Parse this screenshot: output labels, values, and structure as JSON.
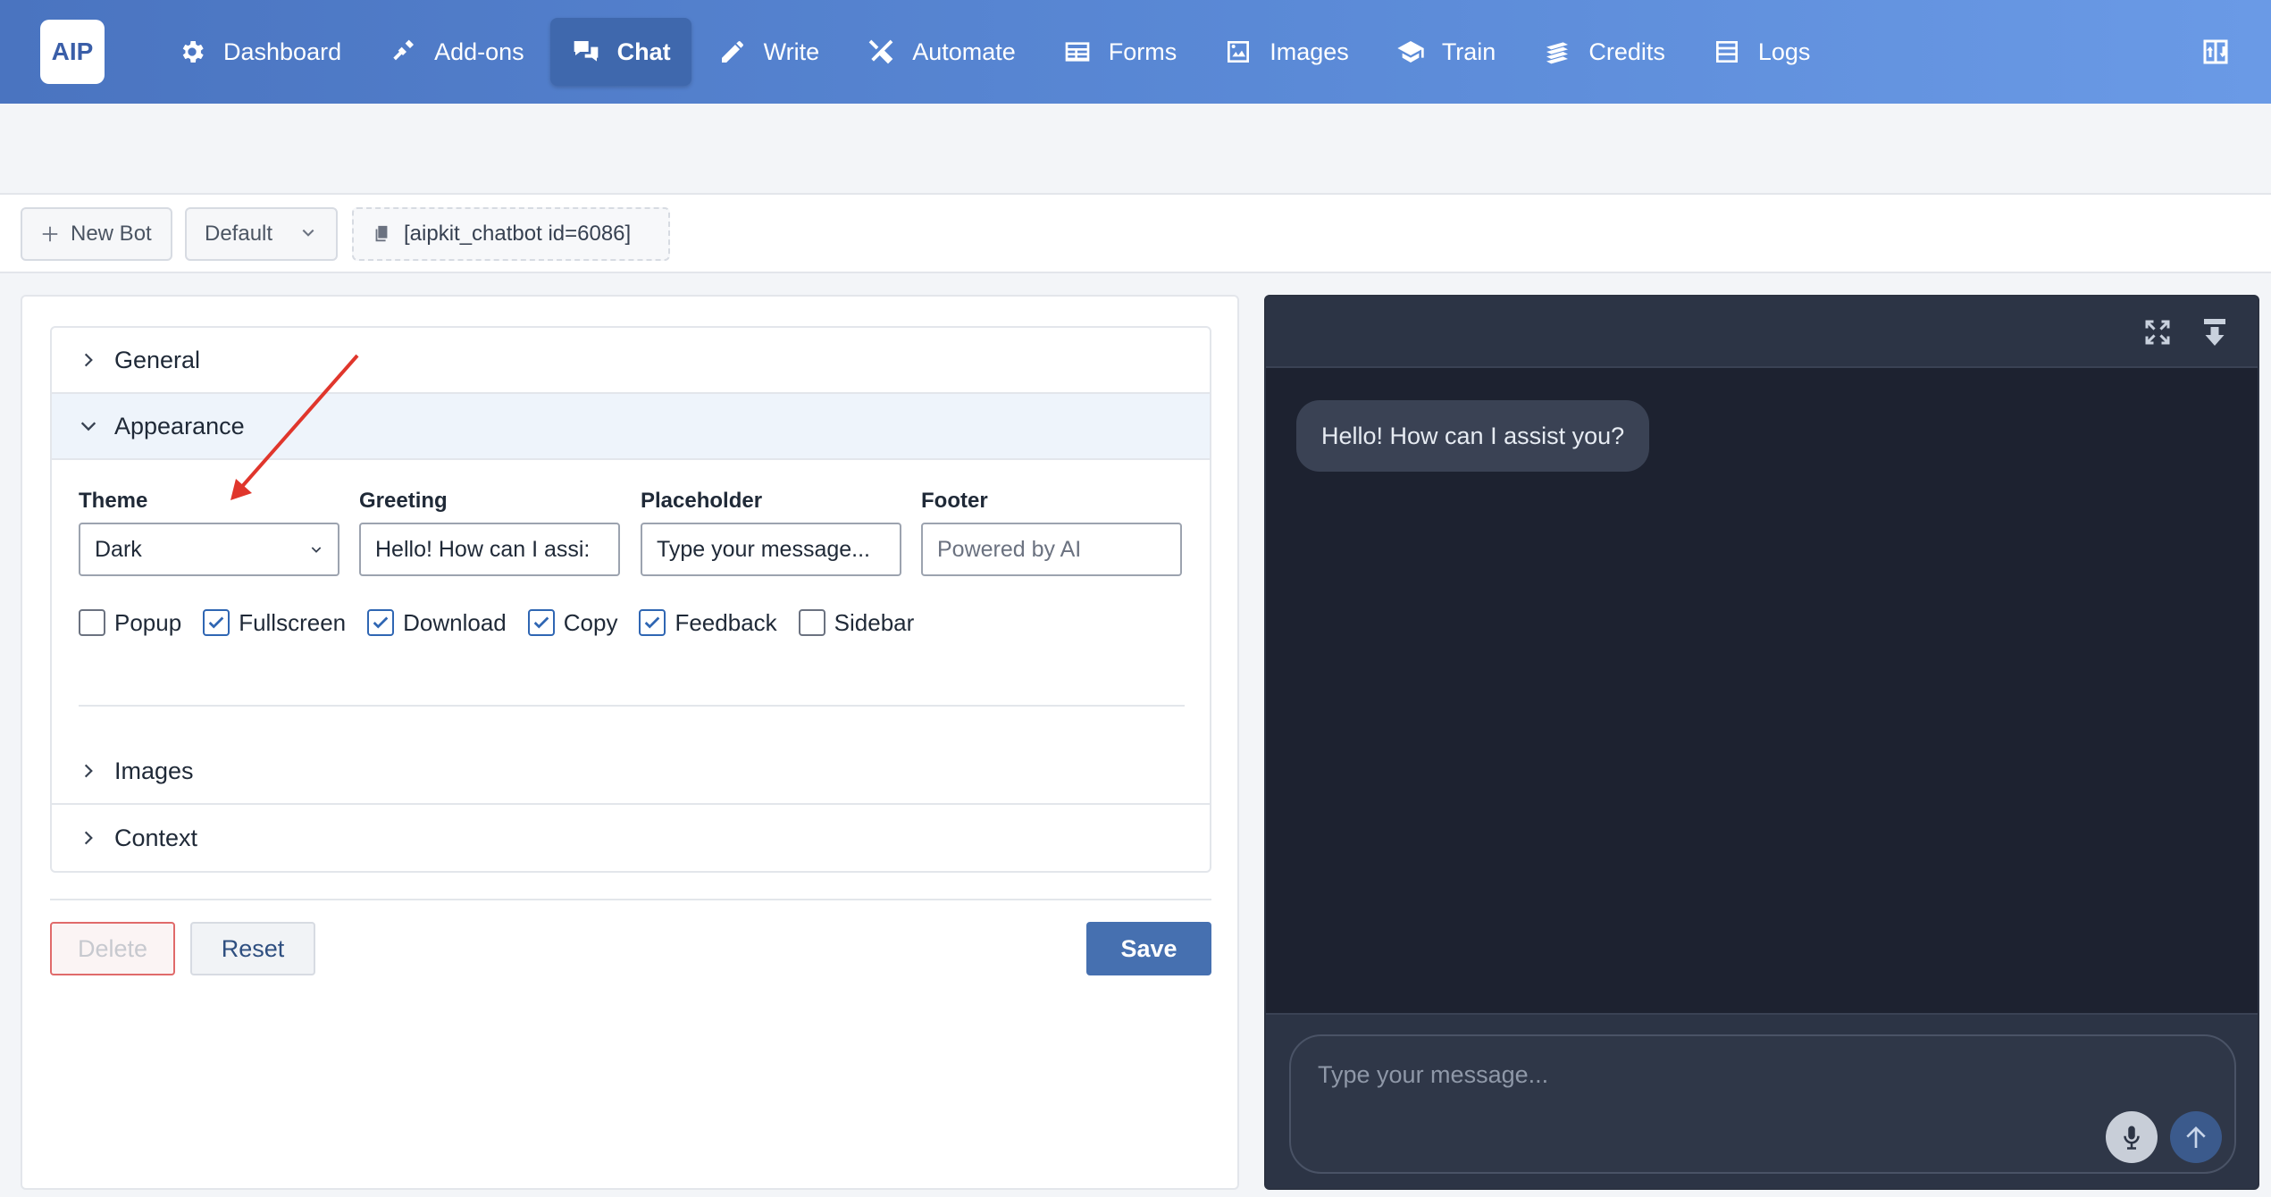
{
  "app": {
    "logo_text": "AIP"
  },
  "nav": {
    "items": [
      {
        "label": "Dashboard",
        "icon": "gear-icon",
        "active": false
      },
      {
        "label": "Add-ons",
        "icon": "plug-icon",
        "active": false
      },
      {
        "label": "Chat",
        "icon": "chat-bubbles-icon",
        "active": true
      },
      {
        "label": "Write",
        "icon": "pencil-icon",
        "active": false
      },
      {
        "label": "Automate",
        "icon": "tools-icon",
        "active": false
      },
      {
        "label": "Forms",
        "icon": "form-icon",
        "active": false
      },
      {
        "label": "Images",
        "icon": "image-icon",
        "active": false
      },
      {
        "label": "Train",
        "icon": "graduation-cap-icon",
        "active": false
      },
      {
        "label": "Credits",
        "icon": "coins-icon",
        "active": false
      },
      {
        "label": "Logs",
        "icon": "list-icon",
        "active": false
      }
    ],
    "corner_icon": "layout-toggle-icon"
  },
  "toolbar": {
    "new_bot": "New Bot",
    "bot_select": "Default",
    "shortcode": "[aipkit_chatbot id=6086]"
  },
  "settings": {
    "sections": {
      "general": "General",
      "appearance": "Appearance",
      "images": "Images",
      "context": "Context"
    },
    "appearance": {
      "theme_label": "Theme",
      "theme_value": "Dark",
      "greeting_label": "Greeting",
      "greeting_value": "Hello! How can I assi:",
      "placeholder_label": "Placeholder",
      "placeholder_value": "Type your message...",
      "footer_label": "Footer",
      "footer_placeholder": "Powered by AI",
      "options": [
        {
          "label": "Popup",
          "checked": false
        },
        {
          "label": "Fullscreen",
          "checked": true
        },
        {
          "label": "Download",
          "checked": true
        },
        {
          "label": "Copy",
          "checked": true
        },
        {
          "label": "Feedback",
          "checked": true
        },
        {
          "label": "Sidebar",
          "checked": false
        }
      ]
    },
    "buttons": {
      "delete": "Delete",
      "reset": "Reset",
      "save": "Save"
    }
  },
  "preview": {
    "greeting_bubble": "Hello! How can I assist you?",
    "input_placeholder": "Type your message...",
    "colors": {
      "background": "#1d2230",
      "header": "#2c3445",
      "bubble": "#3a4254"
    }
  },
  "colors": {
    "nav_start": "#4a74c0",
    "nav_end": "#6a9ae6",
    "accent": "#2f66b3",
    "save": "#4670b0",
    "annotation_arrow": "#e0362c"
  }
}
